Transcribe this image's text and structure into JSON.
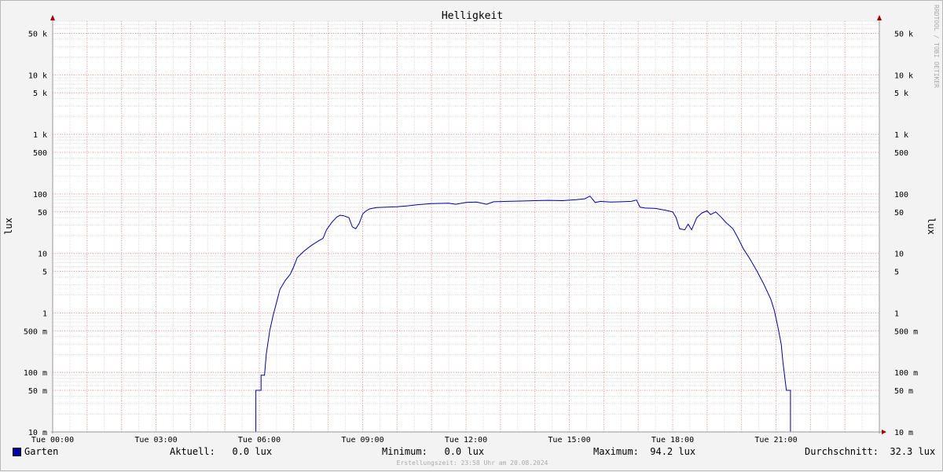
{
  "chart_data": {
    "type": "line",
    "title": "Helligkeit",
    "ylabel_left": "lux",
    "ylabel_right": "lux",
    "watermark": "RRDTOOL / TOBI OETIKER",
    "y_scale": "log",
    "ylim": [
      0.01,
      80000
    ],
    "x_range_hours": [
      0,
      24
    ],
    "x_ticks": [
      {
        "h": 0,
        "label": "Tue 00:00"
      },
      {
        "h": 3,
        "label": "Tue 03:00"
      },
      {
        "h": 6,
        "label": "Tue 06:00"
      },
      {
        "h": 9,
        "label": "Tue 09:00"
      },
      {
        "h": 12,
        "label": "Tue 12:00"
      },
      {
        "h": 15,
        "label": "Tue 15:00"
      },
      {
        "h": 18,
        "label": "Tue 18:00"
      },
      {
        "h": 21,
        "label": "Tue 21:00"
      }
    ],
    "y_ticks": [
      {
        "v": 50000,
        "label": "50 k"
      },
      {
        "v": 10000,
        "label": "10 k"
      },
      {
        "v": 5000,
        "label": "5 k"
      },
      {
        "v": 1000,
        "label": "1 k"
      },
      {
        "v": 500,
        "label": "500"
      },
      {
        "v": 100,
        "label": "100"
      },
      {
        "v": 50,
        "label": "50"
      },
      {
        "v": 10,
        "label": "10"
      },
      {
        "v": 5,
        "label": "5"
      },
      {
        "v": 1,
        "label": "1"
      },
      {
        "v": 0.5,
        "label": "500 m"
      },
      {
        "v": 0.1,
        "label": "100 m"
      },
      {
        "v": 0.05,
        "label": "50 m"
      },
      {
        "v": 0.01,
        "label": "10 m"
      }
    ],
    "series": [
      {
        "name": "Garten",
        "color": "#0000a0",
        "points": [
          [
            0,
            0.01
          ],
          [
            5.9,
            0.01
          ],
          [
            5.9,
            0.05
          ],
          [
            6.05,
            0.05
          ],
          [
            6.05,
            0.09
          ],
          [
            6.15,
            0.09
          ],
          [
            6.2,
            0.2
          ],
          [
            6.3,
            0.5
          ],
          [
            6.4,
            0.9
          ],
          [
            6.5,
            1.5
          ],
          [
            6.6,
            2.5
          ],
          [
            6.75,
            3.5
          ],
          [
            6.9,
            4.5
          ],
          [
            7.0,
            6
          ],
          [
            7.1,
            8.5
          ],
          [
            7.3,
            11
          ],
          [
            7.5,
            13.5
          ],
          [
            7.7,
            16
          ],
          [
            7.85,
            18
          ],
          [
            7.95,
            25
          ],
          [
            8.1,
            33
          ],
          [
            8.25,
            41
          ],
          [
            8.35,
            44
          ],
          [
            8.45,
            43
          ],
          [
            8.6,
            40
          ],
          [
            8.7,
            28
          ],
          [
            8.8,
            26
          ],
          [
            8.9,
            32
          ],
          [
            9.0,
            46
          ],
          [
            9.1,
            52
          ],
          [
            9.2,
            56
          ],
          [
            9.4,
            59
          ],
          [
            9.7,
            60
          ],
          [
            10.0,
            61
          ],
          [
            10.3,
            63
          ],
          [
            10.6,
            66
          ],
          [
            11.0,
            69
          ],
          [
            11.5,
            70
          ],
          [
            11.7,
            67
          ],
          [
            12.0,
            72
          ],
          [
            12.3,
            73
          ],
          [
            12.6,
            67
          ],
          [
            12.8,
            74
          ],
          [
            13.2,
            75
          ],
          [
            13.6,
            76
          ],
          [
            14.0,
            77
          ],
          [
            14.4,
            78
          ],
          [
            14.8,
            77
          ],
          [
            15.2,
            80
          ],
          [
            15.45,
            83
          ],
          [
            15.6,
            92
          ],
          [
            15.75,
            72
          ],
          [
            15.9,
            75
          ],
          [
            16.2,
            73
          ],
          [
            16.5,
            74
          ],
          [
            16.8,
            75
          ],
          [
            16.95,
            79
          ],
          [
            17.05,
            60
          ],
          [
            17.2,
            58
          ],
          [
            17.5,
            57
          ],
          [
            17.8,
            53
          ],
          [
            18.0,
            50
          ],
          [
            18.1,
            40
          ],
          [
            18.2,
            26
          ],
          [
            18.35,
            25
          ],
          [
            18.45,
            31
          ],
          [
            18.55,
            25
          ],
          [
            18.7,
            40
          ],
          [
            18.85,
            48
          ],
          [
            19.0,
            52
          ],
          [
            19.1,
            45
          ],
          [
            19.25,
            50
          ],
          [
            19.4,
            41
          ],
          [
            19.55,
            33
          ],
          [
            19.75,
            26
          ],
          [
            19.9,
            18
          ],
          [
            20.05,
            12
          ],
          [
            20.25,
            8
          ],
          [
            20.45,
            5
          ],
          [
            20.65,
            3
          ],
          [
            20.85,
            1.7
          ],
          [
            20.95,
            1.1
          ],
          [
            21.05,
            0.6
          ],
          [
            21.15,
            0.3
          ],
          [
            21.2,
            0.15
          ],
          [
            21.3,
            0.05
          ],
          [
            21.42,
            0.05
          ],
          [
            21.42,
            0.01
          ],
          [
            24,
            0.01
          ]
        ]
      }
    ]
  },
  "legend": {
    "series_name": "Garten",
    "aktuell": "Aktuell:   0.0 lux",
    "minimum": "Minimum:   0.0 lux",
    "maximum": "Maximum:  94.2 lux",
    "durchschnitt": "Durchschnitt:  32.3 lux"
  },
  "footer": "Erstellungszeit: 23:58 Uhr am 20.08.2024"
}
